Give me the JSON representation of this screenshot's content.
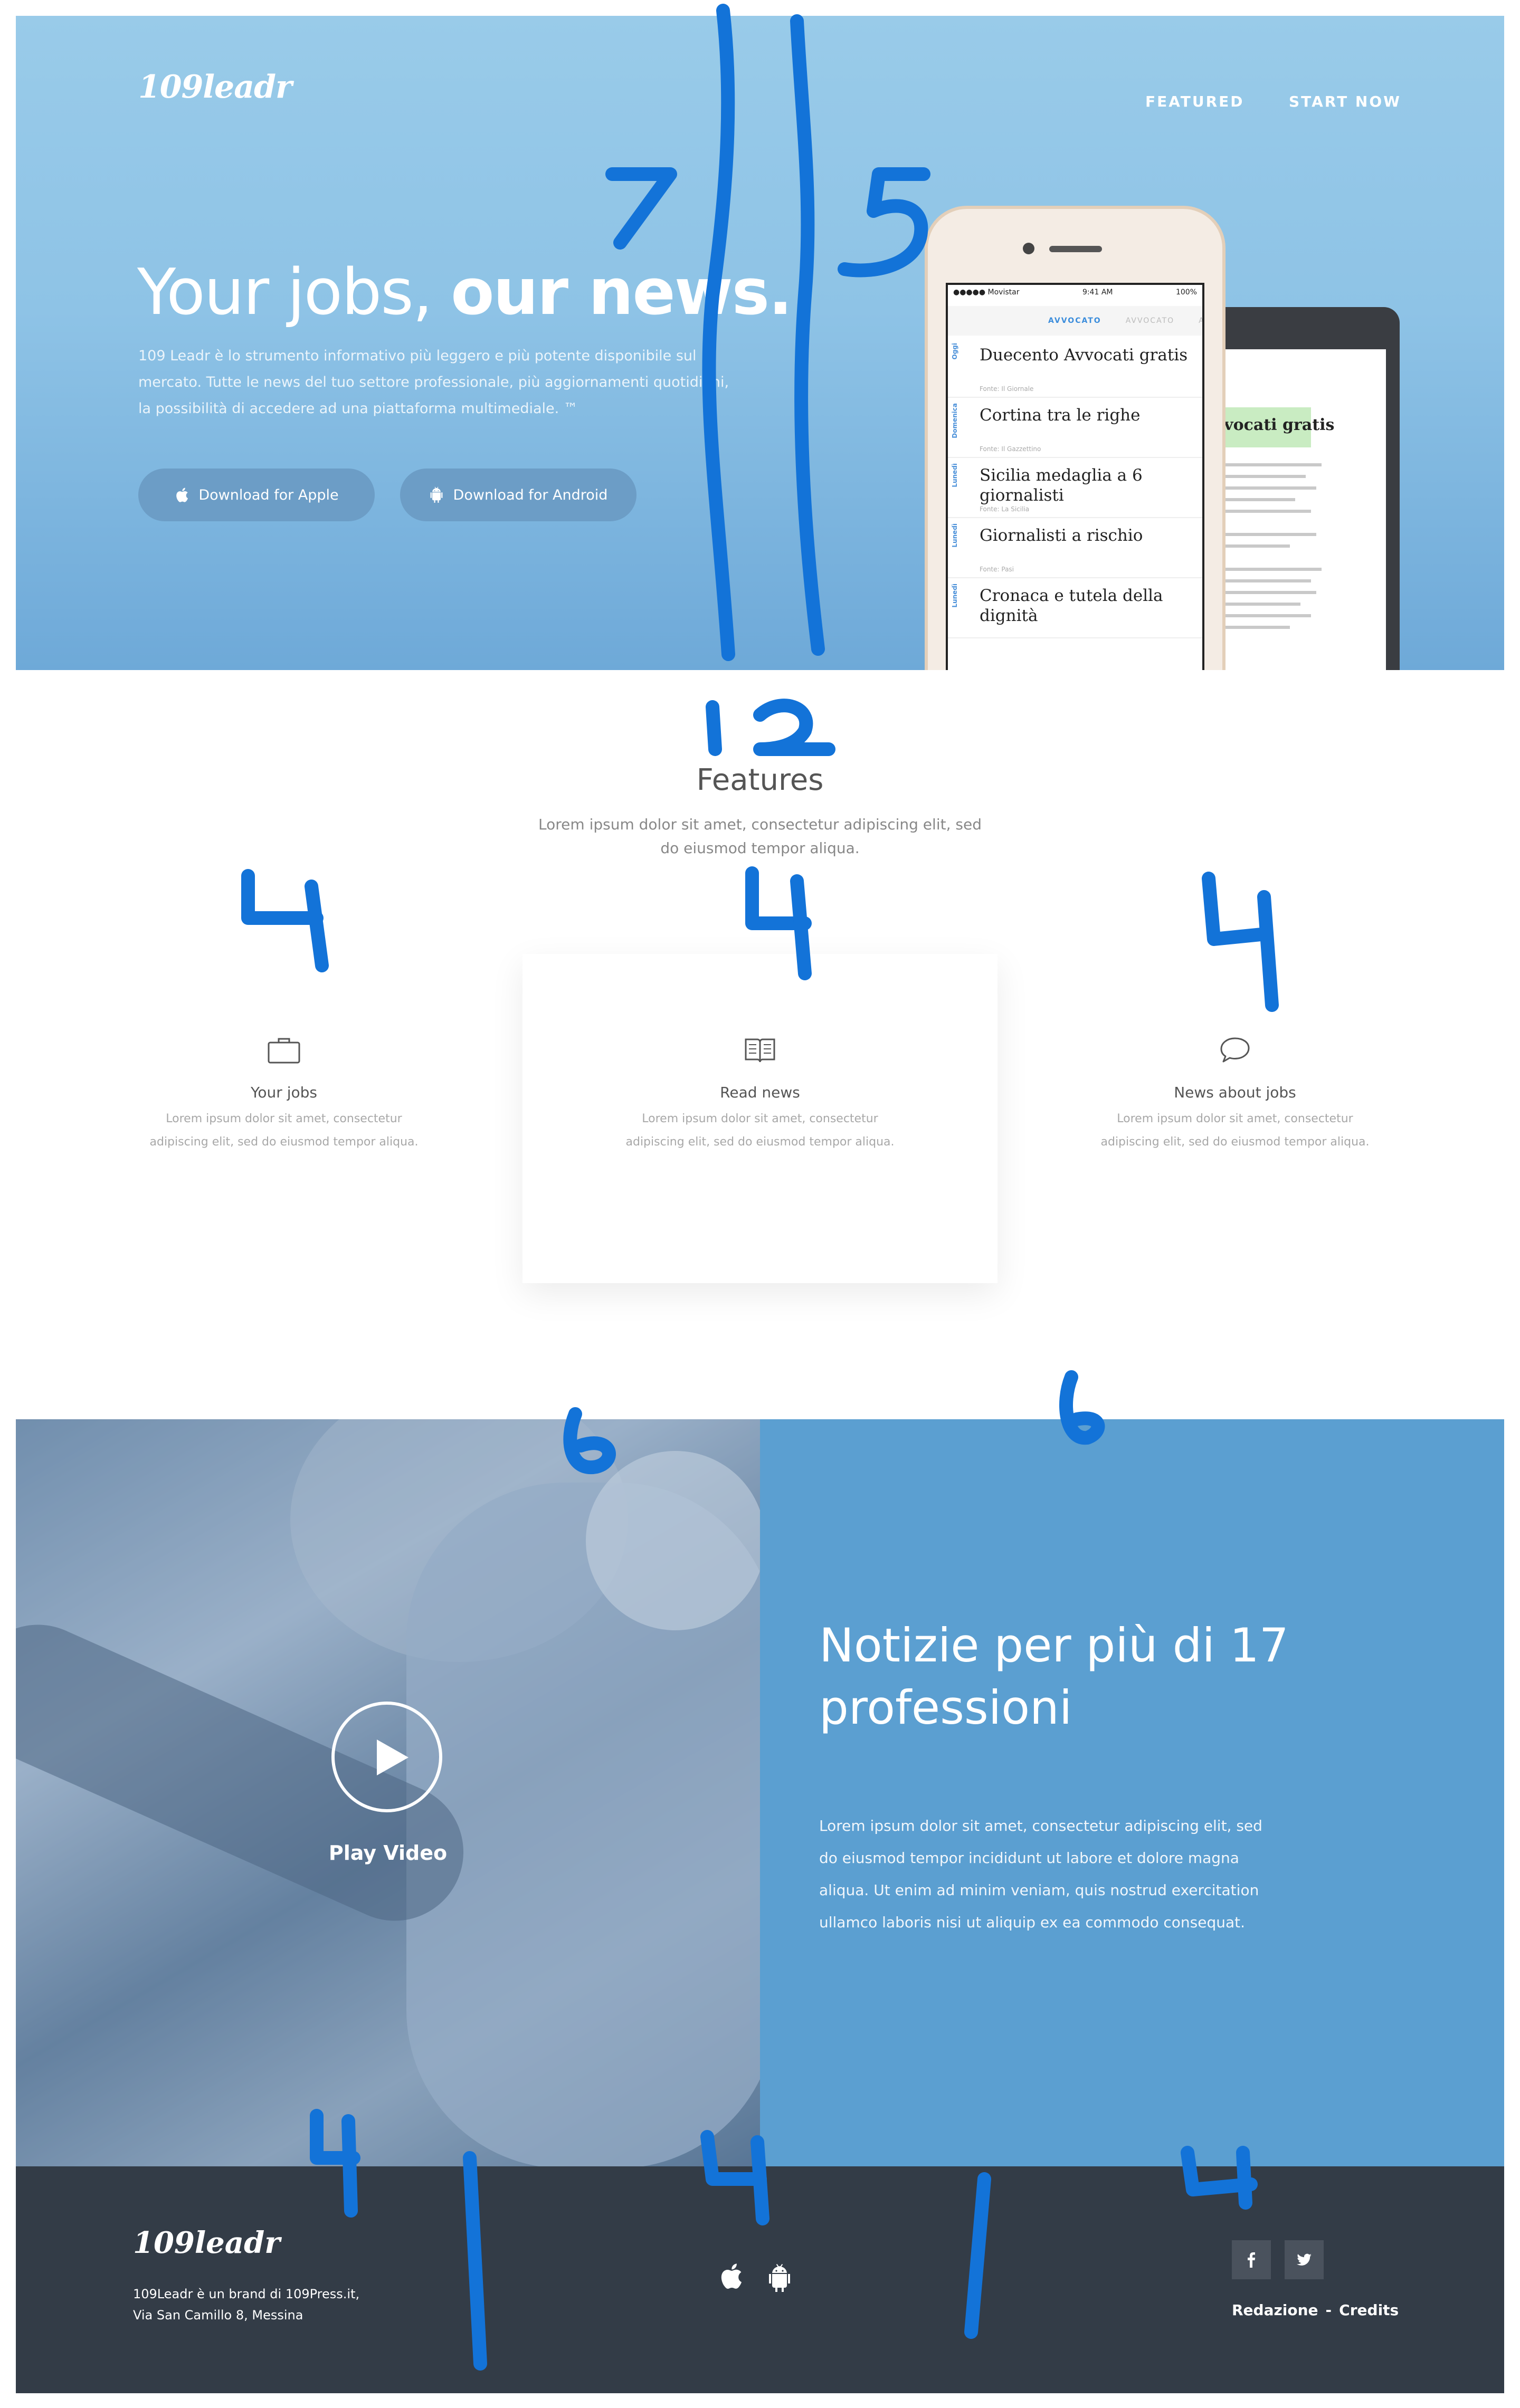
{
  "hero": {
    "logo": "109leadr",
    "nav": [
      "FEATURED",
      "START NOW"
    ],
    "title_light": "Your jobs, ",
    "title_bold": "our news.",
    "description": "109 Leadr è lo strumento informativo più leggero e più potente disponibile sul mercato. Tutte le news del tuo settore professionale, più aggiornamenti quotidiani, la possibilità di accedere ad una piattaforma multimediale. ™",
    "buttons": {
      "apple": "Download for Apple",
      "android": "Download for Android"
    },
    "phone": {
      "carrier": "●●●●● Movistar",
      "time": "9:41 AM",
      "battery": "100%",
      "tabs": [
        "AVVOCATO",
        "AVVOCATO",
        "AV"
      ],
      "news": [
        {
          "day": "Oggi",
          "title": "Duecento Avvocati gratis",
          "source": "Fonte: Il Giornale"
        },
        {
          "day": "Domenica",
          "title": "Cortina tra le righe",
          "source": "Fonte: Il Gazzettino"
        },
        {
          "day": "Lunedì",
          "title": "Sicilia medaglia a 6 giornalisti",
          "source": "Fonte: La Sicilia"
        },
        {
          "day": "Lunedì",
          "title": "Giornalisti a rischio",
          "source": "Fonte: Pasi"
        },
        {
          "day": "Lunedì",
          "title": "Cronaca e tutela della dignità",
          "source": ""
        }
      ]
    },
    "android_article": {
      "headline": "to avvocati gratis"
    }
  },
  "features": {
    "title": "Features",
    "subtitle": "Lorem ipsum dolor sit amet, consectetur adipiscing elit, sed do eiusmod tempor aliqua.",
    "items": [
      {
        "icon": "briefcase-icon",
        "title": "Your jobs",
        "desc": "Lorem ipsum dolor sit amet, consectetur adipiscing elit, sed do eiusmod tempor aliqua."
      },
      {
        "icon": "book-icon",
        "title": "Read news",
        "desc": "Lorem ipsum dolor sit amet, consectetur adipiscing elit, sed do eiusmod tempor aliqua."
      },
      {
        "icon": "chat-bubble-icon",
        "title": "News about jobs",
        "desc": "Lorem ipsum dolor sit amet, consectetur adipiscing elit, sed do eiusmod tempor aliqua."
      }
    ]
  },
  "video": {
    "label": "Play Video"
  },
  "professions": {
    "title": "Notizie per più di 17 professioni",
    "description": "Lorem ipsum dolor sit amet, consectetur adipiscing elit, sed do eiusmod tempor incididunt ut labore et dolore magna aliqua. Ut enim ad minim veniam, quis nostrud exercitation ullamco laboris nisi ut aliquip ex ea commodo consequat."
  },
  "footer": {
    "logo": "109leadr",
    "address_line1": "109Leadr è un brand di 109Press.it,",
    "address_line2": "Via San Camillo 8, Messina",
    "links": [
      "Redazione",
      "-",
      "Credits"
    ]
  },
  "colors": {
    "hero_gradient_top": "#99cbe9",
    "hero_gradient_bottom": "#6ea9d8",
    "accent_blue": "#5b9fd1",
    "footer_bg": "#333c47",
    "annotation_blue": "#1373d8"
  }
}
